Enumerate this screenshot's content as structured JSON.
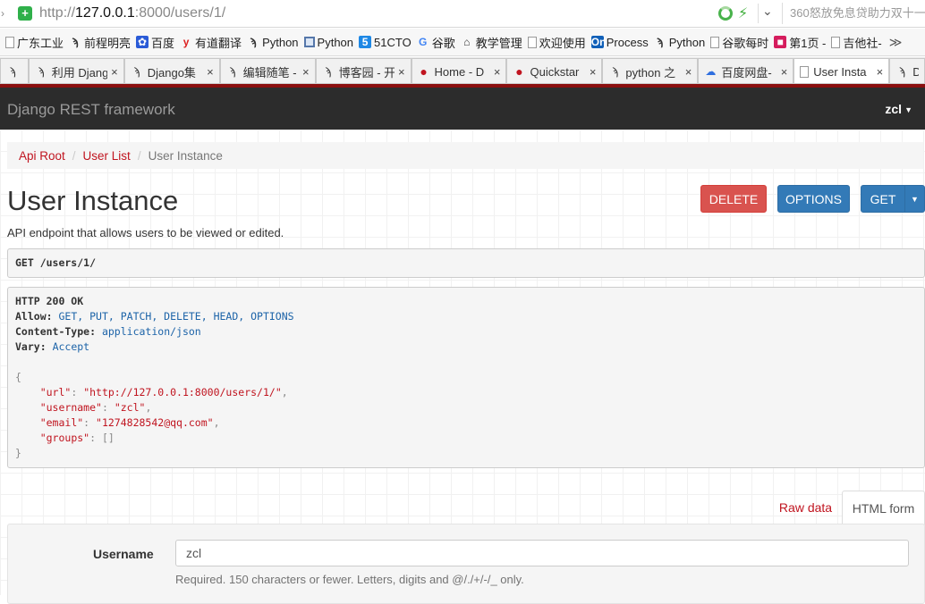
{
  "browser": {
    "url_prefix": "http://",
    "url_host": "127.0.0.1",
    "url_rest": ":8000/users/1/",
    "search_text": "360怒放免息贷助力双十一",
    "bookmarks": [
      {
        "label": "广东工业",
        "icon": "page"
      },
      {
        "label": "前程明亮",
        "icon": "python-logo"
      },
      {
        "label": "百度",
        "icon": "baidu-paw"
      },
      {
        "label": "有道翻译",
        "icon": "youdao"
      },
      {
        "label": "Python",
        "icon": "python-logo"
      },
      {
        "label": "Python",
        "icon": "monitor"
      },
      {
        "label": "51CTO",
        "icon": "51cto"
      },
      {
        "label": "谷歌",
        "icon": "google"
      },
      {
        "label": "教学管理",
        "icon": "building"
      },
      {
        "label": "欢迎使用",
        "icon": "page"
      },
      {
        "label": "Process",
        "icon": "on-logo"
      },
      {
        "label": "Python",
        "icon": "python-logo"
      },
      {
        "label": "谷歌每时",
        "icon": "page"
      },
      {
        "label": "第1页 -",
        "icon": "red-logo"
      },
      {
        "label": "吉他社-",
        "icon": "page"
      }
    ],
    "more": "≫",
    "tabs": [
      {
        "label": "",
        "icon": "python-logo",
        "active": false
      },
      {
        "label": "利用 Djang",
        "icon": "python-logo",
        "active": false
      },
      {
        "label": "Django集",
        "icon": "python-logo",
        "active": false
      },
      {
        "label": "编辑随笔 -",
        "icon": "python-logo",
        "active": false
      },
      {
        "label": "博客园 - 开",
        "icon": "python-logo",
        "active": false
      },
      {
        "label": "Home - D",
        "icon": "django-dot",
        "active": false
      },
      {
        "label": "Quickstar",
        "icon": "django-dot",
        "active": false
      },
      {
        "label": "python 之",
        "icon": "python-logo",
        "active": false
      },
      {
        "label": "百度网盘-",
        "icon": "cloud",
        "active": false
      },
      {
        "label": "User Insta",
        "icon": "page",
        "active": true
      },
      {
        "label": "Dj",
        "icon": "python-logo",
        "active": false
      }
    ]
  },
  "navbar": {
    "brand": "Django REST framework",
    "user": "zcl"
  },
  "breadcrumb": {
    "items": [
      "Api Root",
      "User List"
    ],
    "current": "User Instance"
  },
  "page": {
    "title": "User Instance",
    "description": "API endpoint that allows users to be viewed or edited."
  },
  "buttons": {
    "delete": "DELETE",
    "options": "OPTIONS",
    "get": "GET"
  },
  "request": {
    "text": "GET /users/1/"
  },
  "response": {
    "status": "HTTP 200 OK",
    "allow_key": "Allow:",
    "allow_val": "GET, PUT, PATCH, DELETE, HEAD, OPTIONS",
    "ctype_key": "Content-Type:",
    "ctype_val": "application/json",
    "vary_key": "Vary:",
    "vary_val": "Accept",
    "open": "{",
    "fields": [
      {
        "key": "\"url\"",
        "val": "\"http://127.0.0.1:8000/users/1/\"",
        "sep": ","
      },
      {
        "key": "\"username\"",
        "val": "\"zcl\"",
        "sep": ","
      },
      {
        "key": "\"email\"",
        "val": "\"1274828542@qq.com\"",
        "sep": ","
      },
      {
        "key": "\"groups\"",
        "val": "[]",
        "sep": ""
      }
    ],
    "close": "}"
  },
  "form_tabs": {
    "raw": "Raw data",
    "html": "HTML form"
  },
  "form": {
    "username_label": "Username",
    "username_value": "zcl",
    "username_help": "Required. 150 characters or fewer. Letters, digits and @/./+/-/_ only."
  }
}
